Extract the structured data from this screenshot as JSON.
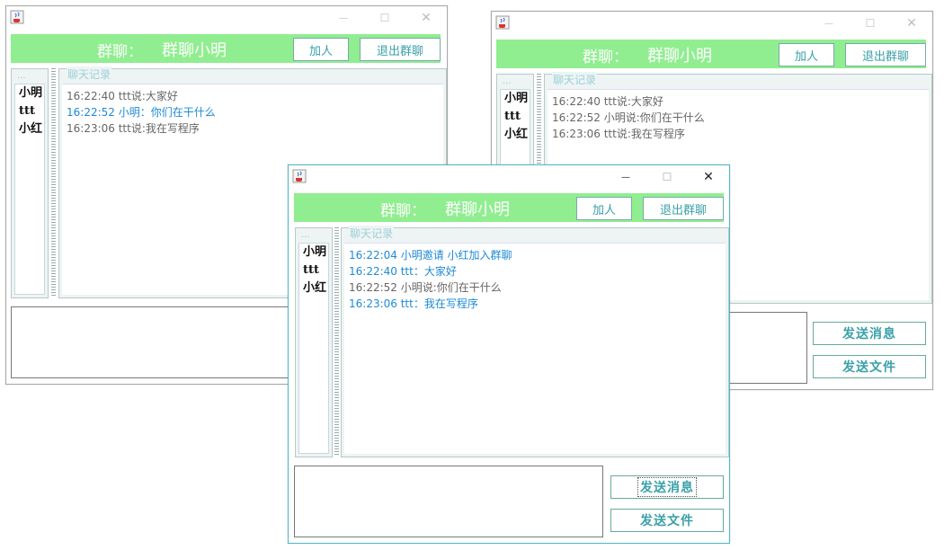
{
  "window_controls": {
    "minimize": "—",
    "maximize": "☐",
    "close": "✕"
  },
  "windows": [
    {
      "id": "win-back-left",
      "header": {
        "label": "群聊：",
        "group_name": "群聊小明",
        "add_button": "加人",
        "quit_button": "退出群聊"
      },
      "member_list": {
        "title": "...",
        "members": [
          "小明",
          "ttt",
          "小红"
        ]
      },
      "chat": {
        "legend": "聊天记录",
        "messages": [
          {
            "text": "16:22:40 ttt说:大家好",
            "color": "gray"
          },
          {
            "text": "16:22:52 小明：你们在干什么",
            "color": "blue"
          },
          {
            "text": "16:23:06 ttt说:我在写程序",
            "color": "gray"
          }
        ]
      }
    },
    {
      "id": "win-back-right",
      "header": {
        "label": "群聊：",
        "group_name": "群聊小明",
        "add_button": "加人",
        "quit_button": "退出群聊"
      },
      "member_list": {
        "title": "...",
        "members": [
          "小明",
          "ttt",
          "小红"
        ]
      },
      "chat": {
        "legend": "聊天记录",
        "messages": [
          {
            "text": "16:22:40 ttt说:大家好",
            "color": "gray"
          },
          {
            "text": "16:22:52 小明说:你们在干什么",
            "color": "gray"
          },
          {
            "text": "16:23:06 ttt说:我在写程序",
            "color": "gray"
          }
        ]
      },
      "send_message_button": "发送消息",
      "send_file_button": "发送文件"
    },
    {
      "id": "win-front",
      "header": {
        "label": "群聊：",
        "group_name": "群聊小明",
        "add_button": "加人",
        "quit_button": "退出群聊"
      },
      "member_list": {
        "title": "...",
        "members": [
          "小明",
          "ttt",
          "小红"
        ]
      },
      "chat": {
        "legend": "聊天记录",
        "messages": [
          {
            "text": "16:22:04 小明邀请  小红加入群聊",
            "color": "blue"
          },
          {
            "text": "16:22:40 ttt：大家好",
            "color": "blue"
          },
          {
            "text": "16:22:52 小明说:你们在干什么",
            "color": "gray"
          },
          {
            "text": "16:23:06 ttt：我在写程序",
            "color": "blue"
          }
        ]
      },
      "send_message_button": "发送消息",
      "send_file_button": "发送文件"
    }
  ],
  "colors": {
    "header_bg": "#90ee90",
    "button_text": "#3aa0a8",
    "message_blue": "#1e8ad6",
    "message_gray": "#666666",
    "active_border": "#52b8c8"
  },
  "icons": {
    "app_icon": "java-coffee-cup-icon"
  }
}
